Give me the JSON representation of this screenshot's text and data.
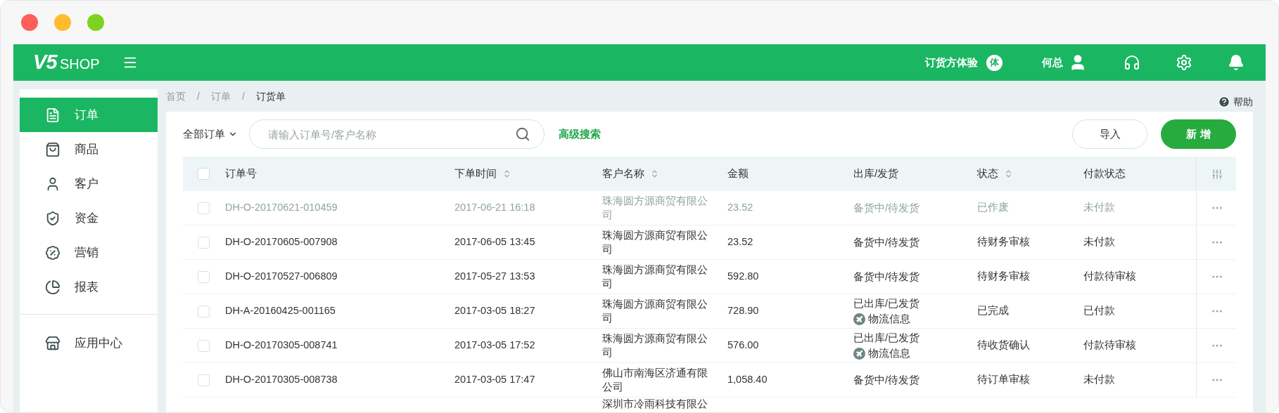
{
  "header": {
    "logo_main": "V5",
    "logo_sub": "SHOP",
    "trial_label": "订货方体验",
    "trial_badge": "体",
    "user": "何总"
  },
  "sidebar": {
    "items": [
      {
        "label": "订单",
        "selected": true
      },
      {
        "label": "商品",
        "selected": false
      },
      {
        "label": "客户",
        "selected": false
      },
      {
        "label": "资金",
        "selected": false
      },
      {
        "label": "营销",
        "selected": false
      },
      {
        "label": "报表",
        "selected": false
      }
    ],
    "bottom_items": [
      {
        "label": "应用中心",
        "selected": false
      }
    ]
  },
  "breadcrumb": [
    "首页",
    "订单",
    "订货单"
  ],
  "breadcrumb_separator": "/",
  "help": "帮助",
  "toolbar": {
    "filter": "全部订单",
    "search_placeholder": "请输入订单号/客户名称",
    "advanced_search": "高级搜索",
    "import": "导入",
    "create": "新 增"
  },
  "table": {
    "select_all_checked": false,
    "columns": [
      {
        "label": "订单号",
        "sortable": false
      },
      {
        "label": "下单时间",
        "sortable": true
      },
      {
        "label": "客户名称",
        "sortable": true
      },
      {
        "label": "金额",
        "sortable": false
      },
      {
        "label": "出库/发货",
        "sortable": false
      },
      {
        "label": "状态",
        "sortable": true
      },
      {
        "label": "付款状态",
        "sortable": false
      }
    ],
    "rows": [
      {
        "order_no": "DH-O-20170621-010459",
        "time": "2017-06-21 16:18",
        "customer": "珠海圆方源商贸有限公司",
        "amount": "23.52",
        "shipping": "备货中/待发货",
        "status": "已作废",
        "payment": "未付款",
        "disabled": true,
        "checked": false
      },
      {
        "order_no": "DH-O-20170605-007908",
        "time": "2017-06-05 13:45",
        "customer": "珠海圆方源商贸有限公司",
        "amount": "23.52",
        "shipping": "备货中/待发货",
        "status": "待财务审核",
        "payment": "未付款",
        "disabled": false,
        "checked": false
      },
      {
        "order_no": "DH-O-20170527-006809",
        "time": "2017-05-27 13:53",
        "customer": "珠海圆方源商贸有限公司",
        "amount": "592.80",
        "shipping": "备货中/待发货",
        "status": "待财务审核",
        "payment": "付款待审核",
        "disabled": false,
        "checked": false
      },
      {
        "order_no": "DH-A-20160425-001165",
        "time": "2017-03-05 18:27",
        "customer": "珠海圆方源商贸有限公司",
        "amount": "728.90",
        "shipping": "已出库/已发货",
        "logistics": "物流信息",
        "status": "已完成",
        "payment": "已付款",
        "disabled": false,
        "checked": false
      },
      {
        "order_no": "DH-O-20170305-008741",
        "time": "2017-03-05 17:52",
        "customer": "珠海圆方源商贸有限公司",
        "amount": "576.00",
        "shipping": "已出库/已发货",
        "logistics": "物流信息",
        "status": "待收货确认",
        "payment": "付款待审核",
        "disabled": false,
        "checked": false
      },
      {
        "order_no": "DH-O-20170305-008738",
        "time": "2017-03-05 17:47",
        "customer": "佛山市南海区济通有限公司",
        "amount": "1,058.40",
        "shipping": "备货中/待发货",
        "status": "待订单审核",
        "payment": "未付款",
        "disabled": false,
        "checked": false
      }
    ],
    "partial_row": {
      "customer": "深圳市冷雨科技有限公"
    }
  }
}
